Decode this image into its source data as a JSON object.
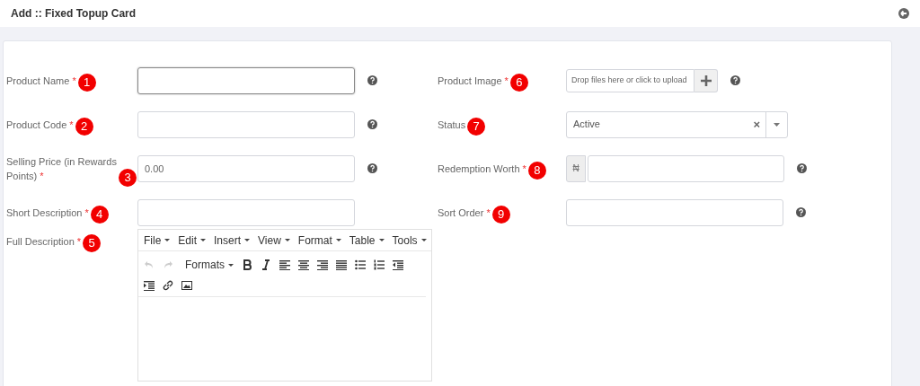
{
  "header": {
    "title": "Add :: Fixed Topup Card"
  },
  "left_fields": [
    {
      "label": "Product Name",
      "asterisk": "*",
      "marker": "1",
      "kind": "text",
      "focused": true,
      "help": true
    },
    {
      "label": "Product Code",
      "asterisk": "*",
      "marker": "2",
      "kind": "text",
      "focused": false,
      "help": true
    },
    {
      "label": "Selling Price (in Rewards Points)",
      "asterisk": "*",
      "marker": "3",
      "kind": "text",
      "value": "0.00",
      "focused": false,
      "help": true
    },
    {
      "label": "Short Description",
      "asterisk": "*",
      "marker": "4",
      "kind": "text",
      "focused": false,
      "help": false
    },
    {
      "label": "Full Description",
      "asterisk": "*",
      "marker": "5",
      "kind": "editor"
    }
  ],
  "right_fields": [
    {
      "label": "Product Image",
      "asterisk": "*",
      "marker": "6",
      "kind": "upload",
      "placeholder": "Drop files here or click to upload",
      "help": true
    },
    {
      "label": "Status",
      "marker": "7",
      "kind": "select",
      "value": "Active",
      "clear": "×",
      "help": false
    },
    {
      "label": "Redemption Worth",
      "asterisk": "*",
      "marker": "8",
      "kind": "currency",
      "prefix": "₦",
      "help": true
    },
    {
      "label": "Sort Order",
      "asterisk": "*",
      "marker": "9",
      "kind": "text",
      "focused": false,
      "help": true
    }
  ],
  "editor": {
    "menus": [
      "File",
      "Edit",
      "Insert",
      "View",
      "Format",
      "Table",
      "Tools"
    ],
    "formats_label": "Formats",
    "undo_disabled": true,
    "redo_disabled": true
  }
}
